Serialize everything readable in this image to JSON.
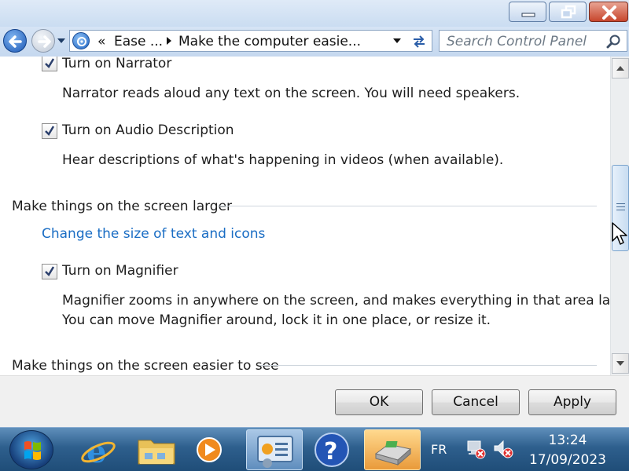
{
  "window": {
    "controls": [
      "minimize",
      "maximize",
      "close"
    ]
  },
  "address_bar": {
    "chevron": "«",
    "crumbs": [
      "Ease ...",
      "Make the computer easie..."
    ]
  },
  "search": {
    "placeholder": "Search Control Panel"
  },
  "content": {
    "narrator": {
      "label": "Turn on Narrator",
      "checked": true,
      "description": "Narrator reads aloud any text on the screen. You will need speakers."
    },
    "audio_description": {
      "label": "Turn on Audio Description",
      "checked": true,
      "description": "Hear descriptions of what's happening in videos (when available)."
    },
    "section_larger": {
      "heading": "Make things on the screen larger",
      "link": "Change the size of text and icons"
    },
    "magnifier": {
      "label": "Turn on Magnifier",
      "checked": true,
      "description_line1": "Magnifier zooms in anywhere on the screen, and makes everything in that area larger.",
      "description_line2": "You can move Magnifier around, lock it in one place, or resize it."
    },
    "section_easier": {
      "heading": "Make things on the screen easier to see"
    }
  },
  "buttons": {
    "ok": "OK",
    "cancel": "Cancel",
    "apply": "Apply"
  },
  "taskbar": {
    "items": [
      "start",
      "internet-explorer",
      "windows-explorer",
      "media-player",
      "control-panel",
      "help",
      "removable-drive"
    ],
    "language": "FR",
    "time": "13:24",
    "date": "17/09/2023"
  },
  "colors": {
    "link": "#1a6dc4",
    "taskbar": "#2e5f8d",
    "close_button": "#c7452c"
  }
}
